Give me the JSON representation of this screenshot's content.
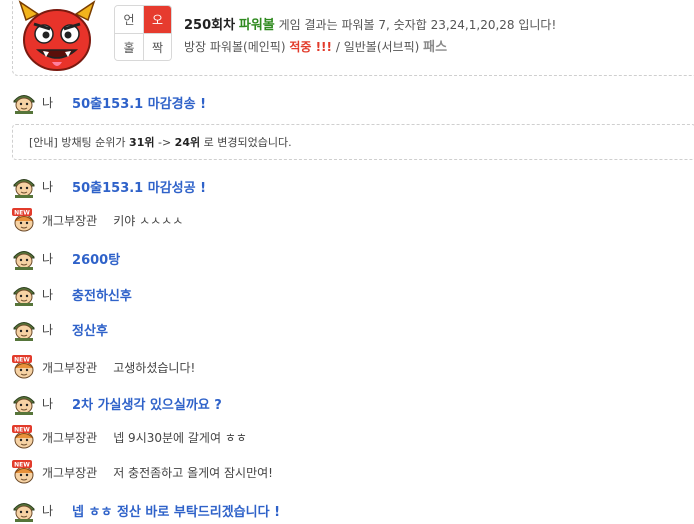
{
  "result": {
    "grid": [
      {
        "label": "언",
        "active": false
      },
      {
        "label": "오",
        "active": true
      },
      {
        "label": "홀",
        "active": false
      },
      {
        "label": "짝",
        "active": false
      }
    ],
    "round": "250회차",
    "game_name": "파워볼",
    "line1_text": "게임 결과는 파워볼 7, 숫자합 23,24,1,20,28 입니다!",
    "line2_prefix": "방장 파워볼(메인픽)",
    "line2_hit": "적중 !!!",
    "line2_mid": "/ 일반볼(서브픽)",
    "line2_pass": "패스"
  },
  "notice": {
    "prefix": "[안내] 방채팅 순위가",
    "from_rank": "31위",
    "arrow": "->",
    "to_rank": "24위",
    "suffix": "로 변경되었습니다."
  },
  "messages": [
    {
      "who": "나",
      "text": "50출153.1 마감경송 !",
      "me": true
    },
    {
      "who": "나",
      "text": "50출153.1 마감성공 !",
      "me": true
    },
    {
      "who": "개그부장관",
      "text": "키야 ㅅㅅㅅㅅ",
      "me": false
    },
    {
      "who": "나",
      "text": "2600탕",
      "me": true
    },
    {
      "who": "나",
      "text": "충전하신후",
      "me": true
    },
    {
      "who": "나",
      "text": "정산후",
      "me": true
    },
    {
      "who": "개그부장관",
      "text": "고생하셨습니다!",
      "me": false
    },
    {
      "who": "나",
      "text": "2차 가실생각 있으실까요 ?",
      "me": true
    },
    {
      "who": "개그부장관",
      "text": "넵 9시30분에 갈게여 ㅎㅎ",
      "me": false
    },
    {
      "who": "개그부장관",
      "text": "저 충전좀하고 올게여 잠시만여!",
      "me": false
    },
    {
      "who": "나",
      "text": "넵 ㅎㅎ 정산 바로 부탁드리겠습니다 !",
      "me": true
    }
  ],
  "badges": {
    "new_label": "NEW"
  },
  "colors": {
    "accent": "#2f62c9",
    "brand": "#2f8a1f",
    "hit": "#e23b2b",
    "active_cell": "#e63b2e"
  },
  "icons": {
    "host": "devil-mascot-icon",
    "me": "soldier-avatar-icon",
    "other": "new-badge-avatar-icon"
  }
}
